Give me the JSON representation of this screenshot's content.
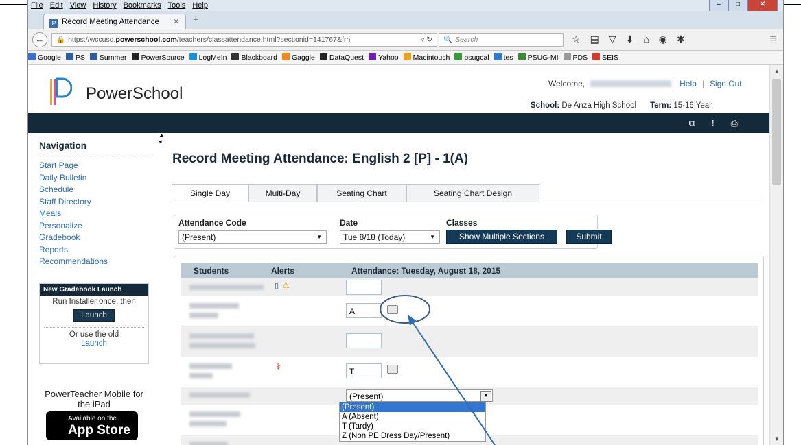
{
  "browser": {
    "menu": [
      "File",
      "Edit",
      "View",
      "History",
      "Bookmarks",
      "Tools",
      "Help"
    ],
    "tab_title": "Record Meeting Attendance",
    "tab_close": "×",
    "new_tab": "+",
    "url_prefix": "https://wccusd.",
    "url_domain": "powerschool.com",
    "url_path": "/teachers/classattendance.html?sectionid=141767&frn",
    "search_placeholder": "Search",
    "bookmarks": [
      {
        "label": "Google",
        "color": "#3b6fd6"
      },
      {
        "label": "PS",
        "color": "#2f5e9e"
      },
      {
        "label": "Summer",
        "color": "#2f5e9e"
      },
      {
        "label": "PowerSource",
        "color": "#222222"
      },
      {
        "label": "LogMeIn",
        "color": "#1e90d6"
      },
      {
        "label": "Blackboard",
        "color": "#333333"
      },
      {
        "label": "Gaggle",
        "color": "#f08a1c"
      },
      {
        "label": "DataQuest",
        "color": "#222222"
      },
      {
        "label": "Yahoo",
        "color": "#6a1fb5"
      },
      {
        "label": "Macintouch",
        "color": "#f0a020"
      },
      {
        "label": "psugcal",
        "color": "#3a9a3a"
      },
      {
        "label": "tes",
        "color": "#2a7ad6"
      },
      {
        "label": "PSUG-MI",
        "color": "#3a8a3a"
      },
      {
        "label": "PDS",
        "color": "#999999"
      },
      {
        "label": "SEIS",
        "color": "#d63a2a"
      }
    ]
  },
  "header": {
    "brand": "PowerSchool",
    "welcome": "Welcome,",
    "help": "Help",
    "sign_out": "Sign Out",
    "school_label": "School:",
    "school_value": "De Anza High School",
    "term_label": "Term:",
    "term_value": "15-16 Year"
  },
  "sidebar": {
    "title": "Navigation",
    "links": [
      "Start Page",
      "Daily Bulletin",
      "Schedule",
      "Staff Directory",
      "Meals",
      "Personalize",
      "Gradebook",
      "Reports",
      "Recommendations"
    ],
    "gradebook_box": {
      "header": "New Gradebook Launch",
      "run_text": "Run Installer once, then",
      "launch_btn": "Launch",
      "old_text": "Or use the old",
      "old_link": "Launch"
    },
    "mobile_text": "PowerTeacher Mobile for the iPad",
    "appstore_line1": "Available on the",
    "appstore_line2": "App Store"
  },
  "main": {
    "title": "Record Meeting Attendance: English 2 [P] - 1(A)",
    "tabs": [
      "Single Day",
      "Multi-Day",
      "Seating Chart",
      "Seating Chart Design"
    ],
    "filters": {
      "code_label": "Attendance Code",
      "code_value": "(Present)",
      "date_label": "Date",
      "date_value": "Tue 8/18 (Today)",
      "classes_label": "Classes",
      "multi_btn": "Show Multiple Sections",
      "submit_btn": "Submit"
    },
    "table": {
      "col_students": "Students",
      "col_alerts": "Alerts",
      "col_attendance": "Attendance: Tuesday, August 18, 2015",
      "rows": [
        {
          "value": ""
        },
        {
          "value": "A"
        },
        {
          "value": ""
        },
        {
          "value": "T"
        },
        {
          "value": "(Present)"
        }
      ],
      "dropdown_options": [
        "(Present)",
        "A (Absent)",
        "T (Tardy)",
        "Z (Non PE Dress Day/Present)"
      ]
    }
  }
}
